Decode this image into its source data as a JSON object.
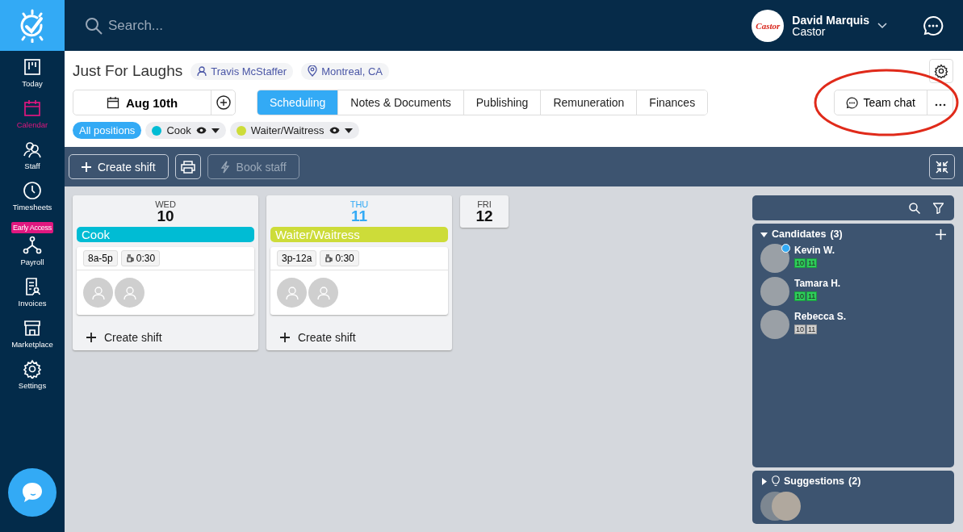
{
  "sidebar": {
    "items": [
      {
        "label": "Today",
        "kind": "board",
        "selected": false
      },
      {
        "label": "Calendar",
        "kind": "calendar",
        "selected": true
      },
      {
        "label": "Staff",
        "kind": "people",
        "selected": false
      },
      {
        "label": "Timesheets",
        "kind": "clock",
        "selected": false
      },
      {
        "label": "Payroll",
        "kind": "network",
        "selected": false,
        "badge": "Early Access"
      },
      {
        "label": "Invoices",
        "kind": "invoice",
        "selected": false
      },
      {
        "label": "Marketplace",
        "kind": "store",
        "selected": false
      },
      {
        "label": "Settings",
        "kind": "gear",
        "selected": false
      }
    ]
  },
  "topbar": {
    "search_placeholder": "Search...",
    "user_name": "David Marquis",
    "company": "Castor",
    "logo_text": "Castor"
  },
  "event": {
    "title": "Just For Laughs",
    "staffer": "Travis McStaffer",
    "location": "Montreal, CA",
    "date": "Aug 10th"
  },
  "tabs": [
    {
      "label": "Scheduling",
      "selected": true
    },
    {
      "label": "Notes & Documents",
      "selected": false
    },
    {
      "label": "Publishing",
      "selected": false
    },
    {
      "label": "Remuneration",
      "selected": false
    },
    {
      "label": "Finances",
      "selected": false
    }
  ],
  "team_chat": "Team chat",
  "positions": [
    {
      "label": "All positions",
      "selected": true
    },
    {
      "label": "Cook",
      "color": "#00bcd4",
      "selected": false
    },
    {
      "label": "Waiter/Waitress",
      "color": "#cddc39",
      "selected": false
    }
  ],
  "toolbar": {
    "create": "Create shift",
    "book": "Book staff"
  },
  "days": [
    {
      "dow": "WED",
      "day": "10",
      "today": false,
      "shifts": [
        {
          "position": "Cook",
          "color": "#00bcd4",
          "time": "8a-5p",
          "break": "0:30",
          "slots": [
            {
              "filled": false
            },
            {
              "filled": false
            }
          ]
        }
      ],
      "create": "Create shift"
    },
    {
      "dow": "THU",
      "day": "11",
      "today": true,
      "shifts": [
        {
          "position": "Waiter/Waitress",
          "color": "#cddc39",
          "time": "3p-12a",
          "break": "0:30",
          "slots": [
            {
              "filled": false
            },
            {
              "filled": false
            }
          ]
        }
      ],
      "create": "Create shift"
    },
    {
      "dow": "FRI",
      "day": "12",
      "today": false
    }
  ],
  "candidates": {
    "title": "Candidates",
    "count": "(3)",
    "expanded": true,
    "items": [
      {
        "name": "Kevin W.",
        "online": true,
        "days": [
          {
            "label": "10",
            "available": true
          },
          {
            "label": "11",
            "available": true
          }
        ]
      },
      {
        "name": "Tamara H.",
        "online": false,
        "days": [
          {
            "label": "10",
            "available": true
          },
          {
            "label": "11",
            "available": true
          }
        ]
      },
      {
        "name": "Rebecca S.",
        "online": false,
        "days": [
          {
            "label": "10",
            "available": false
          },
          {
            "label": "11",
            "available": false
          }
        ]
      }
    ]
  },
  "suggestions": {
    "title": "Suggestions",
    "count": "(2)",
    "expanded": false
  }
}
